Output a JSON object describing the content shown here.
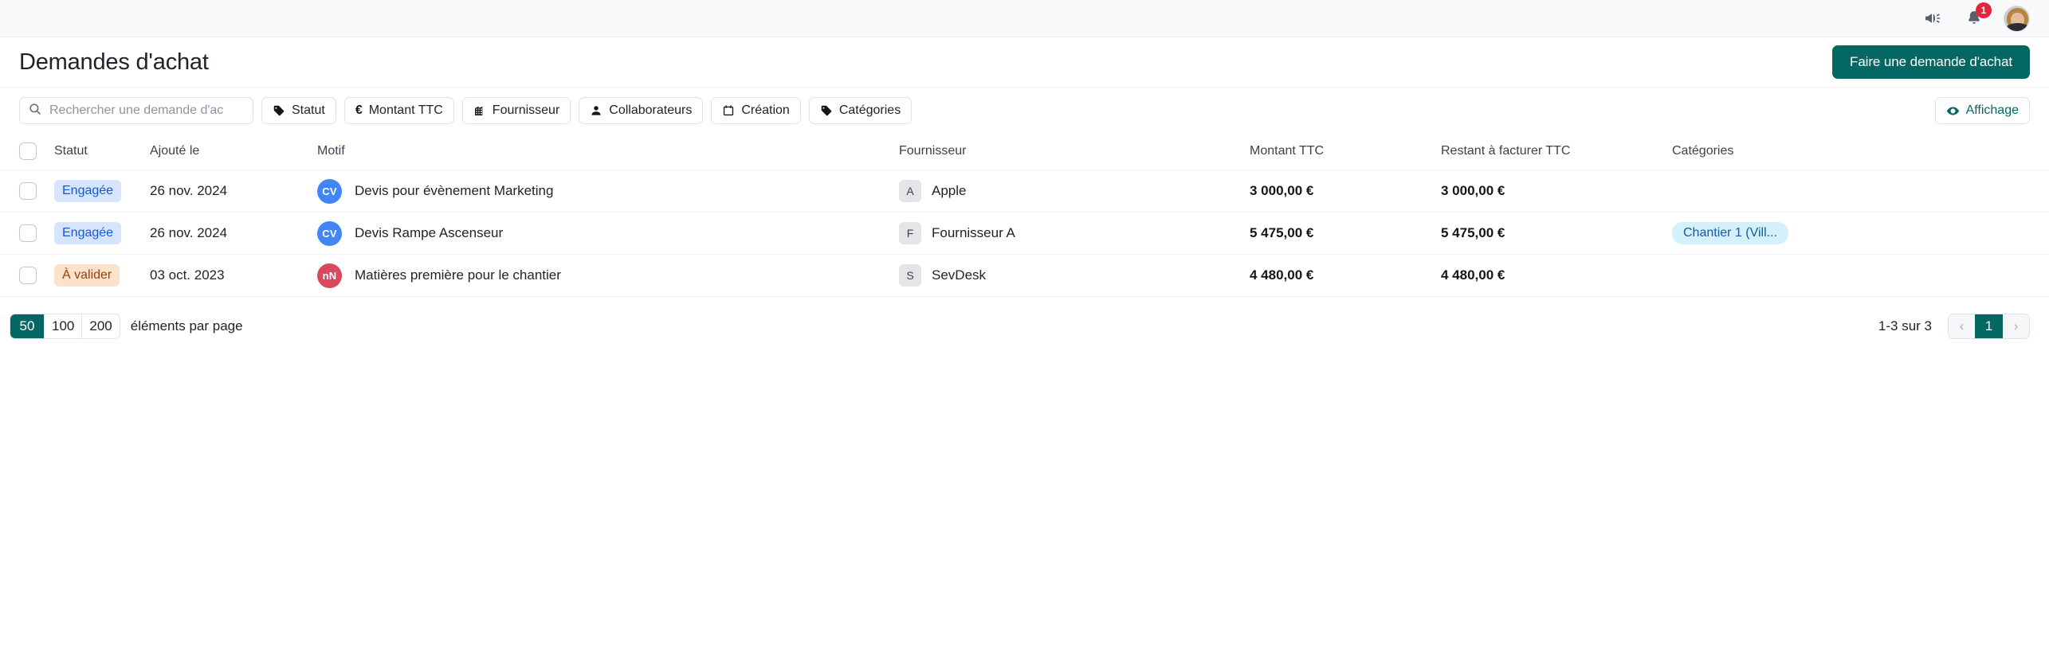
{
  "topbar": {
    "announce_icon": "megaphone-icon",
    "notifications_icon": "bell-icon",
    "notification_count": "1",
    "avatar_alt": "user-avatar"
  },
  "header": {
    "title": "Demandes d'achat",
    "primary_button": "Faire une demande d'achat"
  },
  "toolbar": {
    "search_placeholder": "Rechercher une demande d'ac",
    "search_value": "",
    "filters": [
      {
        "label": "Statut",
        "icon": "tag-icon"
      },
      {
        "label": "Montant TTC",
        "icon": "euro-icon"
      },
      {
        "label": "Fournisseur",
        "icon": "building-icon"
      },
      {
        "label": "Collaborateurs",
        "icon": "person-icon"
      },
      {
        "label": "Création",
        "icon": "calendar-icon"
      },
      {
        "label": "Catégories",
        "icon": "tag-icon"
      }
    ],
    "display_button": {
      "label": "Affichage",
      "icon": "eye-icon"
    }
  },
  "table": {
    "columns": [
      "Statut",
      "Ajouté le",
      "Motif",
      "Fournisseur",
      "Montant TTC",
      "Restant à facturer TTC",
      "Catégories"
    ],
    "rows": [
      {
        "status": "Engagée",
        "status_kind": "engagee",
        "date": "26 nov. 2024",
        "initials": "CV",
        "initials_color": "#4285f4",
        "motif": "Devis pour évènement Marketing",
        "supplier_initial": "A",
        "supplier": "Apple",
        "amount_ttc": "3 000,00 €",
        "remaining_ttc": "3 000,00 €",
        "category": ""
      },
      {
        "status": "Engagée",
        "status_kind": "engagee",
        "date": "26 nov. 2024",
        "initials": "CV",
        "initials_color": "#4285f4",
        "motif": "Devis Rampe Ascenseur",
        "supplier_initial": "F",
        "supplier": "Fournisseur A",
        "amount_ttc": "5 475,00 €",
        "remaining_ttc": "5 475,00 €",
        "category": "Chantier 1 (Vill..."
      },
      {
        "status": "À valider",
        "status_kind": "avalider",
        "date": "03 oct. 2023",
        "initials": "nN",
        "initials_color": "#d8495f",
        "motif": "Matières première pour le chantier",
        "supplier_initial": "S",
        "supplier": "SevDesk",
        "amount_ttc": "4 480,00 €",
        "remaining_ttc": "4 480,00 €",
        "category": ""
      }
    ]
  },
  "footer": {
    "page_sizes": [
      "50",
      "100",
      "200"
    ],
    "page_size_selected": "50",
    "per_page_label": "éléments par page",
    "range_text": "1-3 sur 3",
    "prev_label": "‹",
    "current_page": "1",
    "next_label": "›"
  },
  "colors": {
    "accent": "#046764",
    "badge_red": "#e0253c",
    "status_engagee_bg": "#d7e4ff",
    "status_engagee_fg": "#1459d6",
    "status_avalider_bg": "#fce2cb",
    "status_avalider_fg": "#92400e",
    "category_bg": "#d4f0fa",
    "category_fg": "#1459a6"
  }
}
